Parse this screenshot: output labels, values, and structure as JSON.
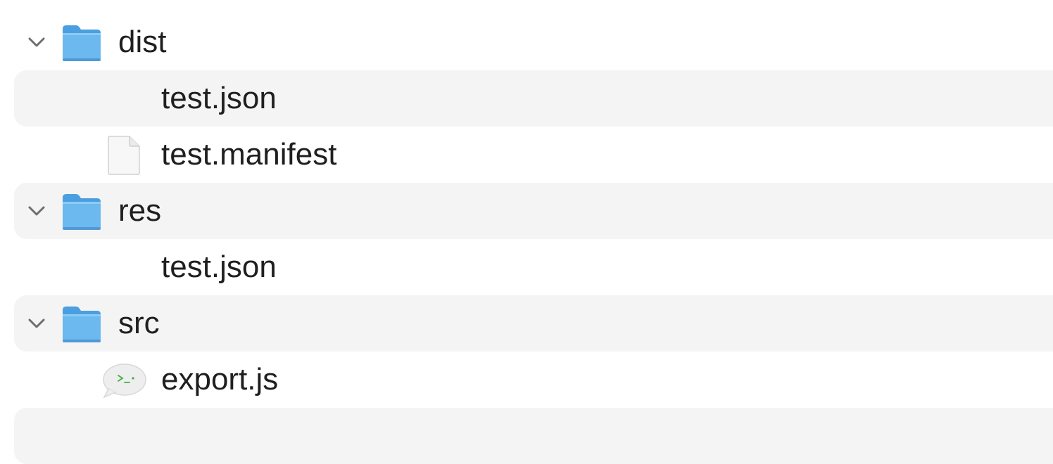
{
  "tree": {
    "items": [
      {
        "name": "dist",
        "kind": "folder",
        "level": 0,
        "expanded": true,
        "icon": "folder-icon"
      },
      {
        "name": "test.json",
        "kind": "file",
        "level": 1,
        "icon": ""
      },
      {
        "name": "test.manifest",
        "kind": "file",
        "level": 1,
        "icon": "document-icon"
      },
      {
        "name": "res",
        "kind": "folder",
        "level": 0,
        "expanded": true,
        "icon": "folder-icon"
      },
      {
        "name": "test.json",
        "kind": "file",
        "level": 1,
        "icon": ""
      },
      {
        "name": "src",
        "kind": "folder",
        "level": 0,
        "expanded": true,
        "icon": "folder-icon"
      },
      {
        "name": "export.js",
        "kind": "file",
        "level": 1,
        "icon": "script-icon"
      },
      {
        "name": "",
        "kind": "empty",
        "level": 0,
        "icon": ""
      }
    ]
  },
  "colors": {
    "alt_row": "#f3f4f3",
    "folder_blue": "#5aaee9",
    "folder_tab": "#4a9fe0",
    "text": "#1f1f1f",
    "chevron": "#6e6e6e"
  }
}
